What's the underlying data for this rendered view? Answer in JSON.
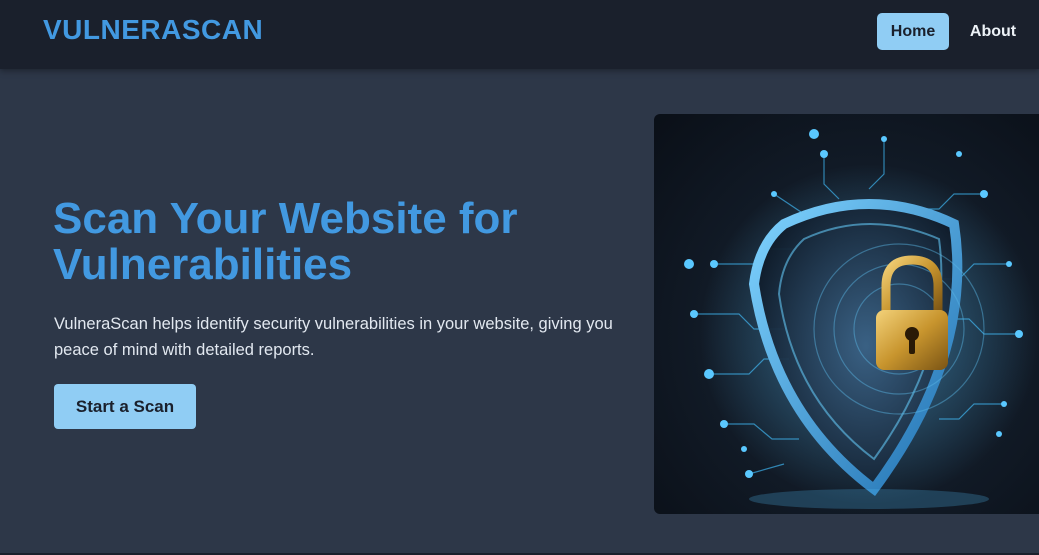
{
  "header": {
    "brand": "VULNERASCAN",
    "nav": {
      "home_label": "Home",
      "about_label": "About"
    }
  },
  "hero": {
    "title": "Scan Your Website for Vulnerabilities",
    "description": "VulneraScan helps identify security vulnerabilities in your website, giving you peace of mind with detailed reports.",
    "cta_label": "Start a Scan",
    "image_subject": "shield-lock-icon"
  },
  "colors": {
    "page_bg": "#2d3748",
    "header_bg": "#1a202c",
    "accent": "#4299e1",
    "button_bg": "#90cdf4",
    "button_text": "#1a202c",
    "body_text": "#e2e8f0"
  }
}
